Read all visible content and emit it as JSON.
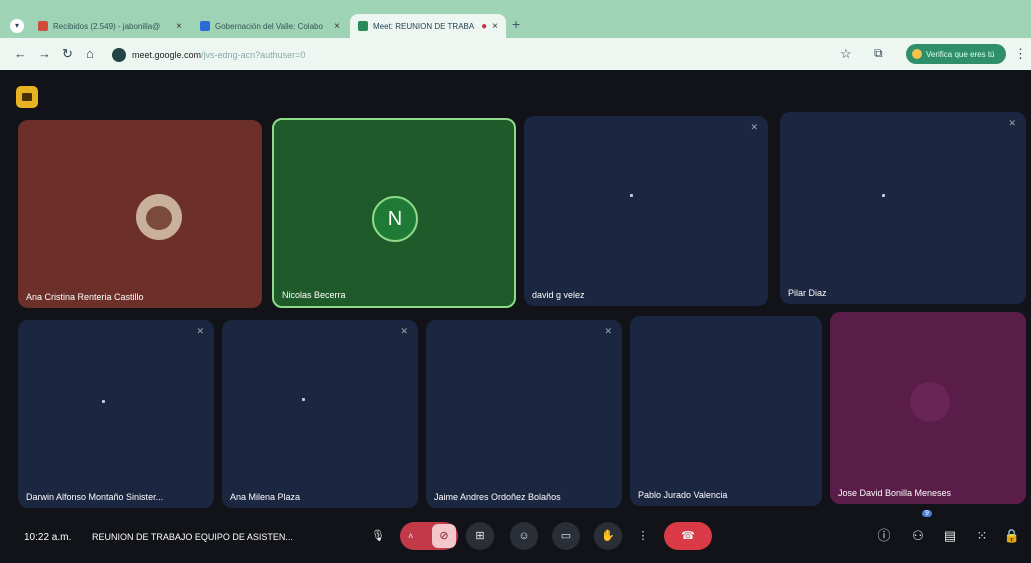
{
  "browser": {
    "tabs": [
      {
        "label": "Recibidos (2.549) - jabonilla@",
        "color": "#d14b3a"
      },
      {
        "label": "Gobernación del Valle: Colabo",
        "color": "#2a6bd4"
      },
      {
        "label": "Meet: REUNION DE TRABA",
        "color": "#2a8a5a",
        "active": true
      }
    ],
    "new_tab": "+",
    "url_host": "meet.google.com",
    "url_path": "/jvs-edng-acn?authuser=0",
    "verify_label": "Verifica que eres tú"
  },
  "participants": [
    {
      "name": "Ana Cristina Renteria Castillo"
    },
    {
      "name": "Nicolas Becerra",
      "initial": "N"
    },
    {
      "name": "david g velez"
    },
    {
      "name": "Pilar Diaz"
    },
    {
      "name": "Darwin Alfonso Montaño Sinister..."
    },
    {
      "name": "Ana Milena Plaza"
    },
    {
      "name": "Jaime Andres Ordoñez Bolaños"
    },
    {
      "name": "Pablo Jurado Valencia"
    },
    {
      "name": "Jose David Bonilla Meneses"
    }
  ],
  "footer": {
    "time": "10:22 a.m.",
    "separator": "|",
    "meeting_title": "REUNION DE TRABAJO EQUIPO DE ASISTEN...",
    "people_count": "9"
  },
  "colors": {
    "meet_bg": "#111318",
    "leave": "#d93a45",
    "cam_off": "#c23a4a"
  }
}
